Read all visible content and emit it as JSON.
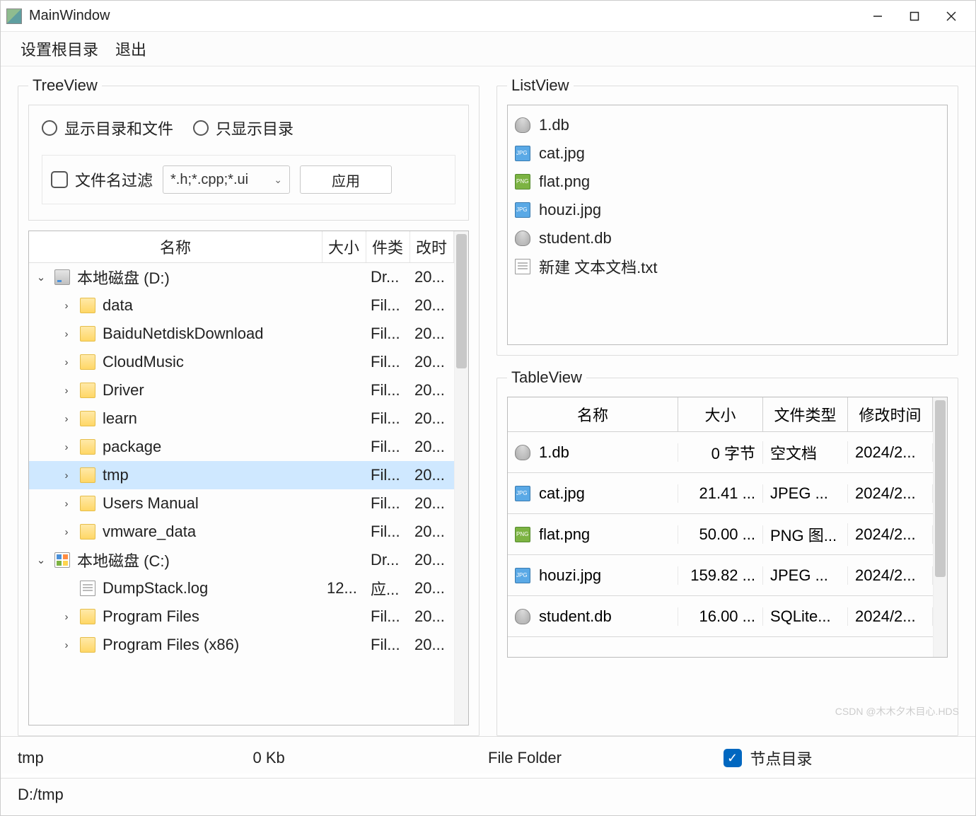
{
  "window": {
    "title": "MainWindow"
  },
  "menu": {
    "set_root": "设置根目录",
    "exit": "退出"
  },
  "groups": {
    "tree": "TreeView",
    "list": "ListView",
    "table": "TableView"
  },
  "filter": {
    "radio_show_all": "显示目录和文件",
    "radio_show_dirs": "只显示目录",
    "check_filter": "文件名过滤",
    "combo_value": "*.h;*.cpp;*.ui",
    "apply": "应用"
  },
  "tree_headers": {
    "name": "名称",
    "size": "大小",
    "type": "件类",
    "mod": "改时"
  },
  "tree": [
    {
      "depth": 0,
      "exp": "v",
      "icon": "drive",
      "name": "本地磁盘 (D:)",
      "size": "",
      "type": "Dr...",
      "mod": "20..."
    },
    {
      "depth": 1,
      "exp": ">",
      "icon": "folder",
      "name": "data",
      "size": "",
      "type": "Fil...",
      "mod": "20..."
    },
    {
      "depth": 1,
      "exp": ">",
      "icon": "folder",
      "name": "BaiduNetdiskDownload",
      "size": "",
      "type": "Fil...",
      "mod": "20..."
    },
    {
      "depth": 1,
      "exp": ">",
      "icon": "folder",
      "name": "CloudMusic",
      "size": "",
      "type": "Fil...",
      "mod": "20..."
    },
    {
      "depth": 1,
      "exp": ">",
      "icon": "folder",
      "name": "Driver",
      "size": "",
      "type": "Fil...",
      "mod": "20..."
    },
    {
      "depth": 1,
      "exp": ">",
      "icon": "folder",
      "name": "learn",
      "size": "",
      "type": "Fil...",
      "mod": "20..."
    },
    {
      "depth": 1,
      "exp": ">",
      "icon": "folder",
      "name": "package",
      "size": "",
      "type": "Fil...",
      "mod": "20..."
    },
    {
      "depth": 1,
      "exp": ">",
      "icon": "folder",
      "name": "tmp",
      "size": "",
      "type": "Fil...",
      "mod": "20...",
      "selected": true
    },
    {
      "depth": 1,
      "exp": ">",
      "icon": "folder",
      "name": "Users Manual",
      "size": "",
      "type": "Fil...",
      "mod": "20..."
    },
    {
      "depth": 1,
      "exp": ">",
      "icon": "folder",
      "name": "vmware_data",
      "size": "",
      "type": "Fil...",
      "mod": "20..."
    },
    {
      "depth": 0,
      "exp": "v",
      "icon": "cdrive",
      "name": "本地磁盘 (C:)",
      "size": "",
      "type": "Dr...",
      "mod": "20..."
    },
    {
      "depth": 1,
      "exp": "",
      "icon": "file",
      "name": "DumpStack.log",
      "size": "12...",
      "type": "应...",
      "mod": "20..."
    },
    {
      "depth": 1,
      "exp": ">",
      "icon": "folder",
      "name": "Program Files",
      "size": "",
      "type": "Fil...",
      "mod": "20..."
    },
    {
      "depth": 1,
      "exp": ">",
      "icon": "folder",
      "name": "Program Files (x86)",
      "size": "",
      "type": "Fil...",
      "mod": "20..."
    }
  ],
  "list": [
    {
      "icon": "db",
      "name": "1.db"
    },
    {
      "icon": "img",
      "name": "cat.jpg"
    },
    {
      "icon": "png",
      "name": "flat.png"
    },
    {
      "icon": "img",
      "name": "houzi.jpg"
    },
    {
      "icon": "db",
      "name": "student.db"
    },
    {
      "icon": "file",
      "name": "新建 文本文档.txt"
    }
  ],
  "table_headers": {
    "name": "名称",
    "size": "大小",
    "type": "文件类型",
    "mod": "修改时间"
  },
  "table": [
    {
      "icon": "db",
      "name": "1.db",
      "size": "0 字节",
      "type": "空文档",
      "mod": "2024/2..."
    },
    {
      "icon": "img",
      "name": "cat.jpg",
      "size": "21.41 ...",
      "type": "JPEG ...",
      "mod": "2024/2..."
    },
    {
      "icon": "png",
      "name": "flat.png",
      "size": "50.00 ...",
      "type": "PNG 图...",
      "mod": "2024/2..."
    },
    {
      "icon": "img",
      "name": "houzi.jpg",
      "size": "159.82 ...",
      "type": "JPEG ...",
      "mod": "2024/2..."
    },
    {
      "icon": "db",
      "name": "student.db",
      "size": "16.00 ...",
      "type": "SQLite...",
      "mod": "2024/2..."
    }
  ],
  "status": {
    "name": "tmp",
    "size": "0 Kb",
    "type": "File Folder",
    "check_label": "节点目录",
    "path": "D:/tmp"
  },
  "watermark": "CSDN @木木夕木目心.HDS"
}
